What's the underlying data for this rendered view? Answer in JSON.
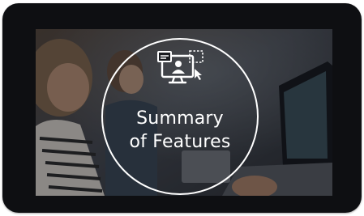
{
  "hero": {
    "title_line1": "Summary",
    "title_line2": "of Features"
  },
  "icons": {
    "feature_icon": "computer-user-screen-icon"
  },
  "colors": {
    "tablet_frame": "#0e0f12",
    "overlay_text": "#ffffff"
  }
}
